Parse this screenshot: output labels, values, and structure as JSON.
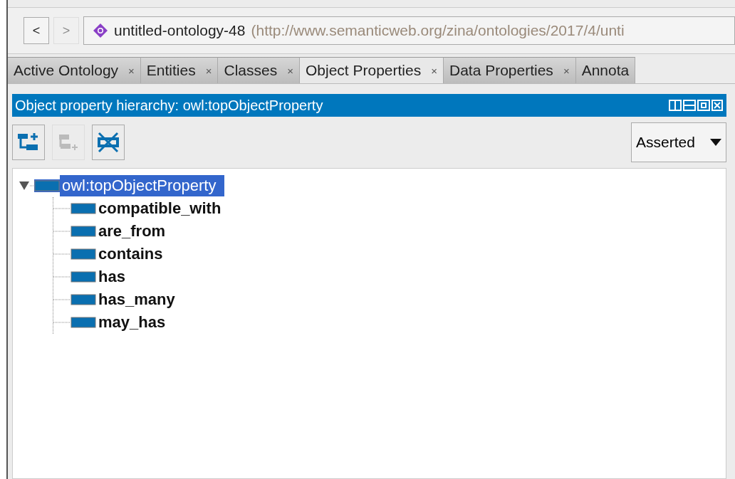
{
  "nav": {
    "back": "<",
    "forward": ">",
    "forward_disabled": true,
    "ontology_name": "untitled-ontology-48",
    "ontology_iri": "(http://www.semanticweb.org/zina/ontologies/2017/4/unti"
  },
  "tabs": [
    {
      "label": "Active Ontology",
      "close": "×",
      "selected": false
    },
    {
      "label": "Entities",
      "close": "×",
      "selected": false
    },
    {
      "label": "Classes",
      "close": "×",
      "selected": false
    },
    {
      "label": "Object Properties",
      "close": "×",
      "selected": true
    },
    {
      "label": "Data Properties",
      "close": "×",
      "selected": false
    },
    {
      "label": "Annota",
      "selected": false
    }
  ],
  "panel": {
    "title": "Object property hierarchy: owl:topObjectProperty",
    "toolbar": [
      {
        "kind": "add-sub",
        "disabled": false
      },
      {
        "kind": "add-sibling",
        "disabled": true
      },
      {
        "kind": "delete",
        "disabled": false
      }
    ],
    "view_select": "Asserted",
    "tree": [
      {
        "label": "owl:topObjectProperty",
        "selected": true,
        "expanded": true,
        "children": [
          {
            "label": "compatible_with",
            "selected": false
          },
          {
            "label": "are_from",
            "selected": false
          },
          {
            "label": "contains",
            "selected": false
          },
          {
            "label": "has",
            "selected": false
          },
          {
            "label": "has_many",
            "selected": false
          },
          {
            "label": "may_has",
            "selected": false
          }
        ]
      }
    ]
  }
}
